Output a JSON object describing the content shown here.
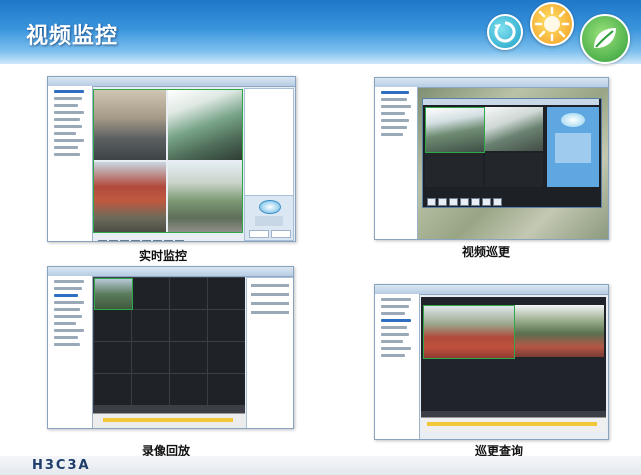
{
  "slide": {
    "title": "视频监控",
    "footer_text": "H3C3A"
  },
  "panels": [
    {
      "caption": "实时监控"
    },
    {
      "caption": "视频巡更"
    },
    {
      "caption": "录像回放"
    },
    {
      "caption": "巡更查询"
    }
  ],
  "colors": {
    "header_blue": "#1f78c8",
    "logo_green": "#36b24a",
    "logo_orange": "#f39a1e",
    "ui_panel": "#e8eef4"
  },
  "icons": [
    "refresh-logo-icon",
    "sun-logo-icon",
    "leaf-logo-icon"
  ]
}
